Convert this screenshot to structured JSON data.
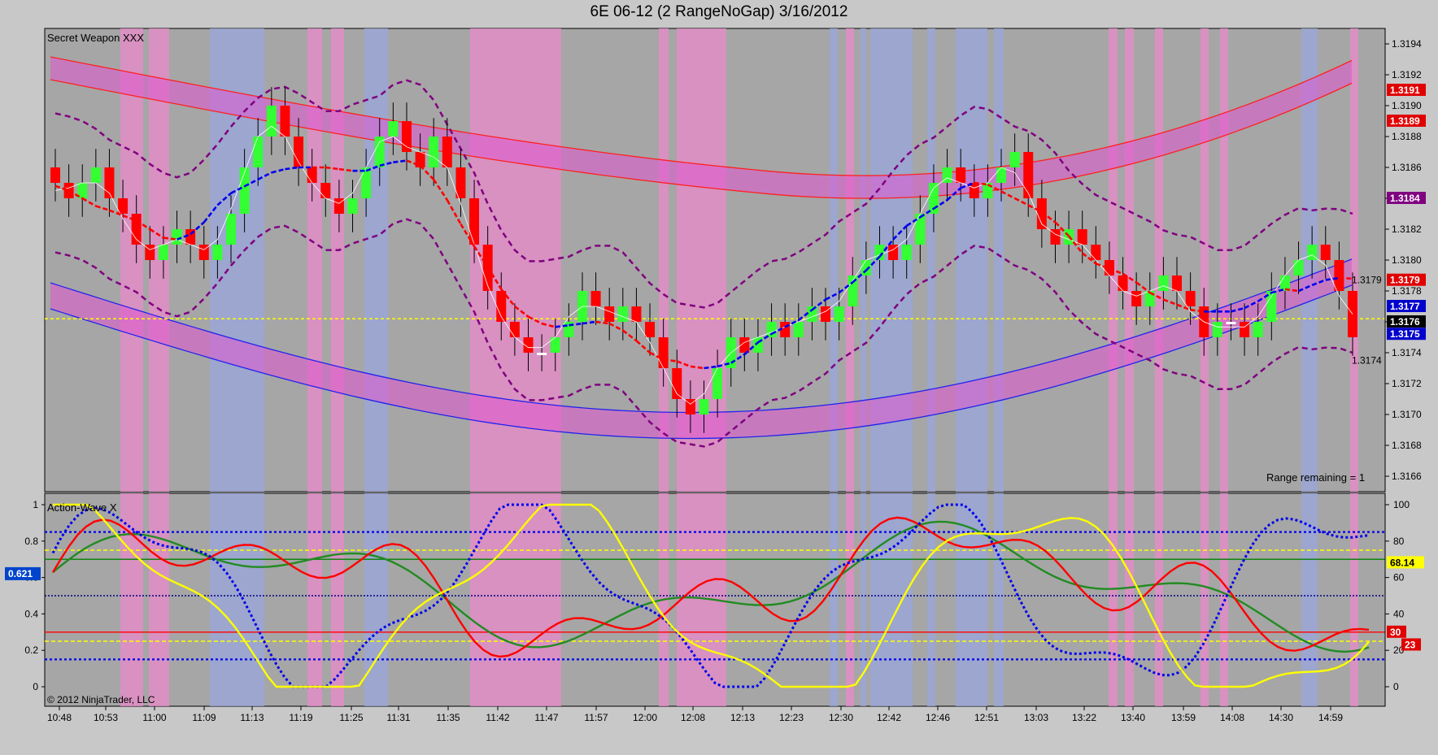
{
  "window": {
    "title": "6E 06-12 (2 RangeNoGap)  3/16/2012"
  },
  "colors": {
    "background": "#a6a6a6",
    "up_bar": "#33ff33",
    "down_bar": "#ff0000",
    "neutral_bar": "#ffffff",
    "red_band": "#e055d0",
    "blue_band": "#e055d0",
    "pink_zone": "#e58cc8",
    "blue_zone": "#9aa6d8",
    "envelope": "#800080",
    "ma_red": "#ff0000",
    "ma_blue": "#0000ee",
    "zero_line": "#ffff00"
  },
  "chart_data": [
    {
      "type": "candlestick",
      "panel": "price",
      "label": "Secret Weapon XXX",
      "ylim": [
        1.3165,
        1.3195
      ],
      "y_ticks": [
        "1.3194",
        "1.3192",
        "1.3190",
        "1.3188",
        "1.3186",
        "1.3184",
        "1.3182",
        "1.3180",
        "1.3178",
        "1.3176",
        "1.3174",
        "1.3172",
        "1.3170",
        "1.3168",
        "1.3166"
      ],
      "x_ticks": [
        "10:48",
        "10:53",
        "11:00",
        "11:09",
        "11:13",
        "11:19",
        "11:25",
        "11:31",
        "11:35",
        "11:42",
        "11:47",
        "11:57",
        "12:00",
        "12:08",
        "12:13",
        "12:23",
        "12:30",
        "12:42",
        "12:46",
        "12:51",
        "13:03",
        "13:22",
        "13:40",
        "13:59",
        "14:08",
        "14:30",
        "14:59"
      ],
      "price_markers": [
        {
          "label": "1.3191",
          "value": 1.3191,
          "color": "#e00000"
        },
        {
          "label": "1.3189",
          "value": 1.3189,
          "color": "#e00000"
        },
        {
          "label": "1.3184",
          "value": 1.3184,
          "color": "#800080"
        },
        {
          "label": "1.3179",
          "value": 1.31787,
          "color": "#e00000"
        },
        {
          "label": "1.3177",
          "value": 1.3177,
          "color": "#0000cc"
        },
        {
          "label": "1.3176",
          "value": 1.3176,
          "color": "#000000"
        },
        {
          "label": "1.3175",
          "value": 1.31752,
          "color": "#0000cc"
        }
      ],
      "annotations": [
        "1.3179",
        "1.3174",
        "Range remaining = 1"
      ],
      "reference_line": 1.31762,
      "series_close": [
        1.3185,
        1.3184,
        1.3185,
        1.3186,
        1.3184,
        1.3183,
        1.3181,
        1.318,
        1.3181,
        1.3182,
        1.3181,
        1.318,
        1.3181,
        1.3183,
        1.3186,
        1.3188,
        1.319,
        1.3188,
        1.3186,
        1.3185,
        1.3184,
        1.3183,
        1.3184,
        1.3186,
        1.3188,
        1.3189,
        1.3187,
        1.3186,
        1.3188,
        1.3186,
        1.3184,
        1.3181,
        1.3178,
        1.3176,
        1.3175,
        1.3174,
        1.3174,
        1.3175,
        1.3176,
        1.3178,
        1.3177,
        1.3176,
        1.3177,
        1.3176,
        1.3175,
        1.3173,
        1.3171,
        1.317,
        1.3171,
        1.3173,
        1.3175,
        1.3174,
        1.3175,
        1.3176,
        1.3175,
        1.3176,
        1.3177,
        1.3176,
        1.3177,
        1.3179,
        1.318,
        1.3181,
        1.318,
        1.3181,
        1.3183,
        1.3185,
        1.3186,
        1.3185,
        1.3184,
        1.3185,
        1.3186,
        1.3187,
        1.3184,
        1.3182,
        1.3181,
        1.3182,
        1.3181,
        1.318,
        1.3179,
        1.3178,
        1.3177,
        1.3178,
        1.3179,
        1.3178,
        1.3177,
        1.3175,
        1.3176,
        1.3176,
        1.3175,
        1.3176,
        1.3178,
        1.3179,
        1.318,
        1.3181,
        1.318,
        1.3178,
        1.3175
      ]
    },
    {
      "type": "line",
      "panel": "oscillator",
      "label": "Action-Wave X",
      "ylim": [
        0,
        1
      ],
      "left_ticks": [
        "1",
        "0.8",
        "0.6",
        "0.4",
        "0.2",
        "0"
      ],
      "right_ticks": [
        "100",
        "80",
        "60",
        "40",
        "20",
        "0"
      ],
      "left_marker": "0.621",
      "right_markers": [
        {
          "label": "68.14",
          "value": 68.14,
          "color": "#ffff00"
        },
        {
          "label": "30",
          "value": 30,
          "color": "#e00000"
        },
        {
          "label": "23",
          "value": 23,
          "color": "#e00000"
        }
      ],
      "levels": [
        85,
        75,
        70,
        50,
        30,
        25,
        15
      ],
      "copyright": "© 2012 NinjaTrader, LLC"
    }
  ]
}
